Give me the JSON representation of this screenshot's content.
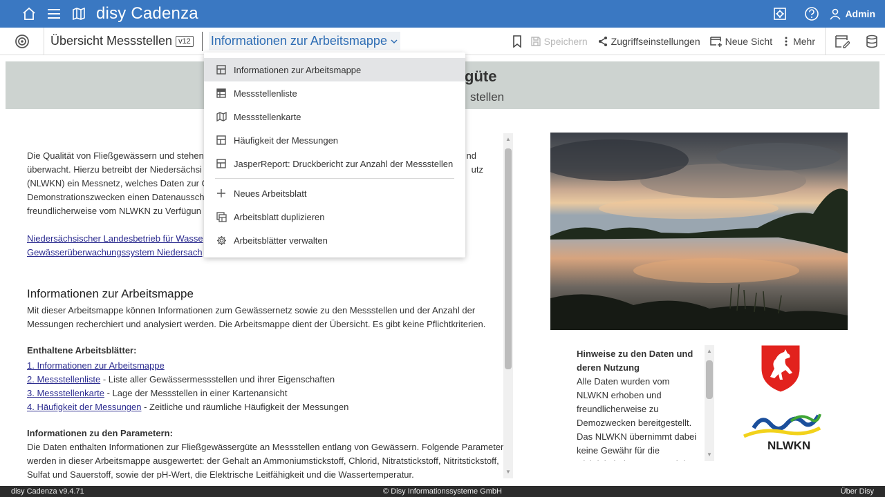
{
  "app": {
    "title": "disy Cadenza"
  },
  "topbar": {
    "user_label": "Admin"
  },
  "toolbar": {
    "workbook_name": "Übersicht Messstellen",
    "version": "v12",
    "current_sheet": "Informationen zur Arbeitsmappe",
    "save_label": "Speichern",
    "access_label": "Zugriffseinstellungen",
    "new_view_label": "Neue Sicht",
    "more_label": "Mehr"
  },
  "banner": {
    "title_fragment": "güte",
    "subtitle_fragment": "stellen"
  },
  "menu": {
    "sheets": [
      {
        "label": "Informationen zur Arbeitsmappe",
        "icon": "sheet-grid-icon",
        "active": true
      },
      {
        "label": "Messstellenliste",
        "icon": "table-icon",
        "active": false
      },
      {
        "label": "Messstellenkarte",
        "icon": "map-icon",
        "active": false
      },
      {
        "label": "Häufigkeit der Messungen",
        "icon": "sheet-grid-icon",
        "active": false
      },
      {
        "label": "JasperReport: Druckbericht zur Anzahl der Messstellen",
        "icon": "sheet-grid-icon",
        "active": false
      }
    ],
    "actions": [
      {
        "label": "Neues Arbeitsblatt",
        "icon": "plus-icon"
      },
      {
        "label": "Arbeitsblatt duplizieren",
        "icon": "duplicate-icon"
      },
      {
        "label": "Arbeitsblätter verwalten",
        "icon": "gear-icon"
      }
    ]
  },
  "main": {
    "intro_lines": [
      "Die Qualität von Fließgewässern und stehen",
      "überwacht. Hierzu betreibt der Niedersächsi",
      "(NLWKN) ein Messnetz, welches Daten zur G",
      "Demonstrationszwecken einen Datenaussch",
      "freundlicherweise vom NLWKN zu Verfügun"
    ],
    "intro_right_fragments": [
      "nd",
      "utz"
    ],
    "source_links": [
      "Niedersächsischer Landesbetrieb für Wasse",
      "Gewässerüberwachungssystem Niedersach"
    ],
    "info_heading": "Informationen zur Arbeitsmappe",
    "info_text": "Mit dieser Arbeitsmappe können Informationen zum Gewässernetz sowie zu den Messstellen und der Anzahl der Messungen recherchiert und analysiert werden. Die Arbeitsmappe dient der Übersicht. Es gibt keine Pflichtkriterien.",
    "sheets_heading": "Enthaltene Arbeitsblätter:",
    "sheet_list": [
      {
        "link": "1. Informationen zur Arbeitsmappe",
        "desc": ""
      },
      {
        "link": "2. Messstellenliste",
        "desc": " - Liste aller Gewässermessstellen und ihrer Eigenschaften"
      },
      {
        "link": "3. Messstellenkarte",
        "desc": " - Lage der Messstellen in einer Kartenansicht"
      },
      {
        "link": "4. Häufigkeit der Messungen",
        "desc": " - Zeitliche und räumliche Häufigkeit der Messungen"
      }
    ],
    "params_heading": "Informationen zu den Parametern:",
    "params_text": "Die Daten enthalten Informationen zur Fließgewässergüte an Messstellen entlang von Gewässern. Folgende Parameter werden in dieser Arbeitsmappe ausgewertet: der Gehalt an Ammoniumstickstoff, Chlorid, Nitratstickstoff, Nitritstickstoff, Sulfat und Sauerstoff, sowie der pH-Wert, die Elektrische Leitfähigkeit und die Wassertemperatur."
  },
  "hinweise": {
    "title": "Hinweise zu den Daten und deren Nutzung",
    "text": "Alle Daten wurden vom NLWKN erhoben und freundlicherweise zu Demozwecken bereitgestellt. Das NLWKN übernimmt dabei keine Gewähr für die Richtigkeit der Daten. Bei der"
  },
  "logo": {
    "nlwkn_text": "NLWKN"
  },
  "footer": {
    "version": "disy Cadenza v9.4.71",
    "copyright": "© Disy Informationssysteme GmbH",
    "about": "Über Disy"
  },
  "colors": {
    "topbar": "#3a78c2",
    "accent": "#2e6db4",
    "banner": "#cdd3d0",
    "footer": "#2c2c2c"
  }
}
